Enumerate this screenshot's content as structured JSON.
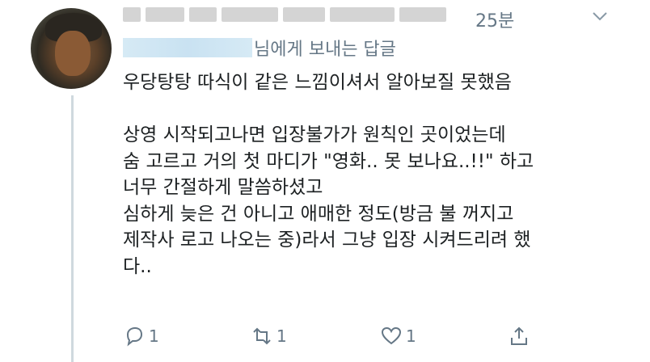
{
  "tweet": {
    "timestamp": "25분",
    "reply_suffix": "님에게 보내는 답글",
    "text": "우당탕탕 따식이 같은 느낌이셔서 알아보질 못했음\n\n상영 시작되고나면 입장불가가 원칙인 곳이었는데\n숨 고르고 거의 첫 마디가 \"영화.. 못 보나요..!!\" 하고\n너무 간절하게 말씀하셨고\n심하게 늦은 건 아니고 애매한 정도(방금 불 꺼지고\n제작사 로고 나오는 중)라서 그냥 입장 시켜드리려 했\n다..",
    "actions": {
      "reply_count": "1",
      "retweet_count": "1",
      "like_count": "1"
    }
  },
  "icons": {
    "menu": "chevron-down-icon",
    "reply": "reply-icon",
    "retweet": "retweet-icon",
    "like": "heart-icon",
    "share": "share-icon"
  },
  "colors": {
    "secondary_text": "#657786",
    "primary_text": "#1c2022",
    "thread_line": "#cfd9de"
  }
}
